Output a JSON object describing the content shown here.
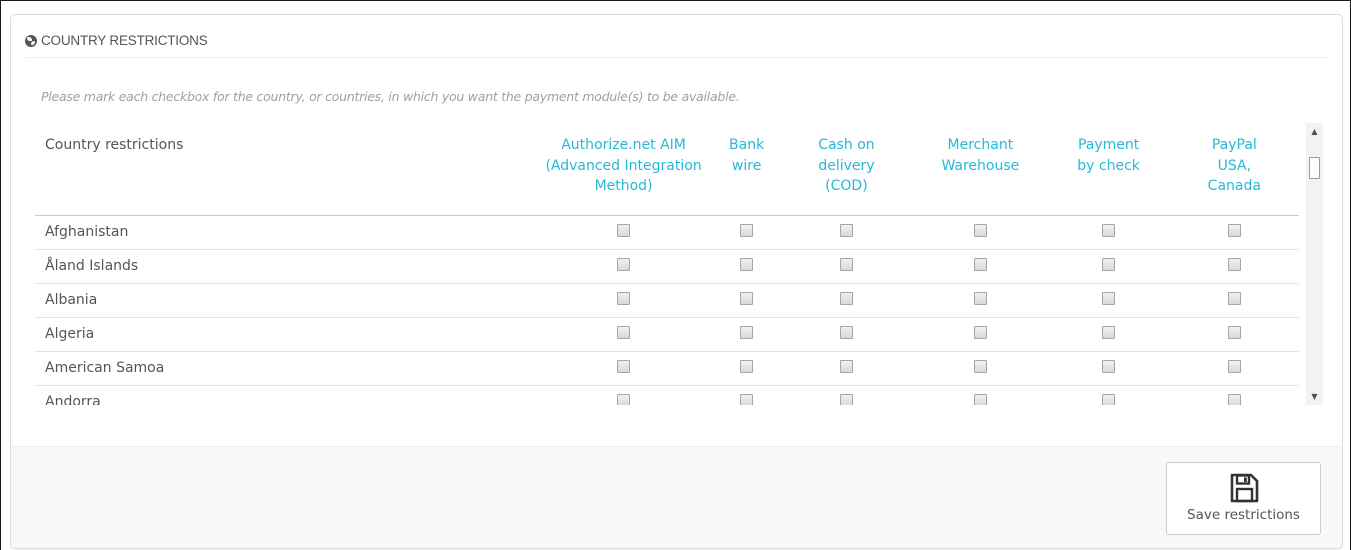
{
  "section": {
    "title": "COUNTRY RESTRICTIONS",
    "icon": "globe-icon"
  },
  "help_text": "Please mark each checkbox for the country, or countries, in which you want the payment module(s) to be available.",
  "table": {
    "country_header": "Country restrictions",
    "modules": [
      {
        "line1": "Authorize.net AIM",
        "line2": "(Advanced Integration",
        "line3": "Method)"
      },
      {
        "line1": "Bank",
        "line2": "wire",
        "line3": ""
      },
      {
        "line1": "Cash on",
        "line2": "delivery",
        "line3": "(COD)"
      },
      {
        "line1": "Merchant",
        "line2": "Warehouse",
        "line3": ""
      },
      {
        "line1": "Payment",
        "line2": "by check",
        "line3": ""
      },
      {
        "line1": "PayPal",
        "line2": "USA,",
        "line3": "Canada"
      }
    ],
    "rows": [
      {
        "country": "Afghanistan",
        "checked": [
          false,
          false,
          false,
          false,
          false,
          false
        ]
      },
      {
        "country": "Åland Islands",
        "checked": [
          false,
          false,
          false,
          false,
          false,
          false
        ]
      },
      {
        "country": "Albania",
        "checked": [
          false,
          false,
          false,
          false,
          false,
          false
        ]
      },
      {
        "country": "Algeria",
        "checked": [
          false,
          false,
          false,
          false,
          false,
          false
        ]
      },
      {
        "country": "American Samoa",
        "checked": [
          false,
          false,
          false,
          false,
          false,
          false
        ]
      },
      {
        "country": "Andorra",
        "checked": [
          false,
          false,
          false,
          false,
          false,
          false
        ]
      }
    ]
  },
  "footer": {
    "save_label": "Save restrictions",
    "save_icon": "floppy-disk-icon"
  },
  "colors": {
    "accent": "#25b9d7",
    "text": "#555555",
    "muted": "#a0a0a0",
    "footer_bg": "#f6f8fa"
  }
}
